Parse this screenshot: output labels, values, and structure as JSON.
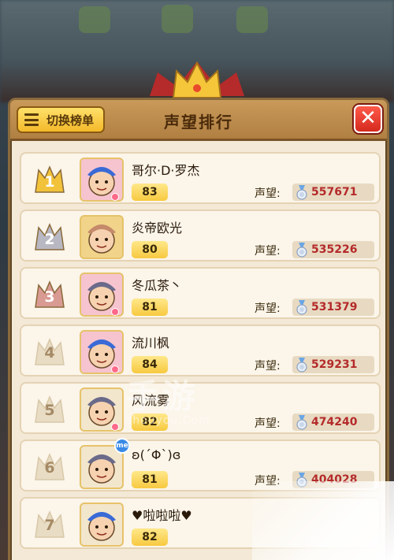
{
  "header": {
    "switch_label": "切换榜单",
    "title": "声望排行",
    "close_glyph": "✕"
  },
  "rep_label": "声望:",
  "rows": [
    {
      "rank": "1",
      "rank_style": "gold",
      "name": "哥尔·D·罗杰",
      "level": "83",
      "reputation": "557671",
      "avatar_icon": "opera-warrior-avatar",
      "avatar_bg": "pink"
    },
    {
      "rank": "2",
      "rank_style": "silver",
      "name": "炎帝欧光",
      "level": "80",
      "reputation": "535226",
      "avatar_icon": "pig-sunglasses-avatar",
      "avatar_bg": "gold"
    },
    {
      "rank": "3",
      "rank_style": "bronze",
      "name": "冬瓜茶丶",
      "level": "81",
      "reputation": "531379",
      "avatar_icon": "opera-warrior-avatar",
      "avatar_bg": "pink"
    },
    {
      "rank": "4",
      "rank_style": "plain",
      "name": "流川枫",
      "level": "84",
      "reputation": "529231",
      "avatar_icon": "wizard-hat-avatar",
      "avatar_bg": "pink"
    },
    {
      "rank": "5",
      "rank_style": "plain",
      "name": "风流雾",
      "level": "82",
      "reputation": "474240",
      "avatar_icon": "straw-hat-swordsman-avatar",
      "avatar_bg": "plain"
    },
    {
      "rank": "6",
      "rank_style": "plain",
      "name": "ʚ(´Φ`)ɞ",
      "level": "81",
      "reputation": "404028",
      "avatar_icon": "silver-hair-avatar",
      "avatar_bg": "plain",
      "badge": "me"
    },
    {
      "rank": "7",
      "rank_style": "plain",
      "name": "♥啦啦啦♥",
      "level": "82",
      "reputation": "",
      "avatar_icon": "red-cap-plumber-avatar",
      "avatar_bg": "plain"
    }
  ],
  "watermark": {
    "big": "手游",
    "small": "shouyou.Com"
  },
  "colors": {
    "gold": "#f2c23a",
    "silver": "#b8b8c2",
    "bronze": "#d89a92",
    "plain": "#e8dcc4",
    "reputation_value": "#b42a2a"
  }
}
